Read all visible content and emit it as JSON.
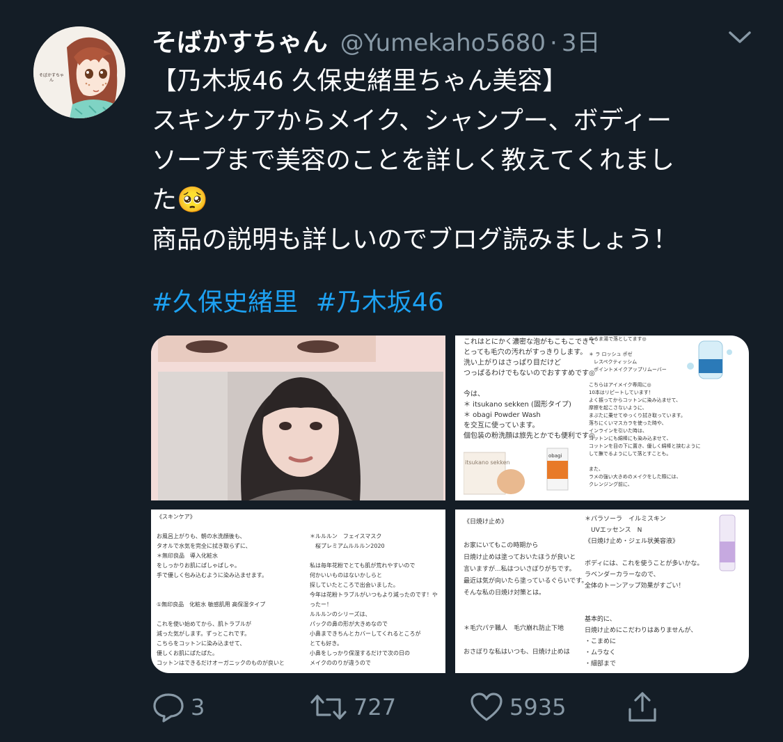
{
  "tweet": {
    "avatar_label": "そばかすちゃん",
    "display_name": "そばかすちゃん",
    "handle": "@Yumekaho5680",
    "separator": "·",
    "time": "3日",
    "lines": [
      "【乃木坂46 久保史緒里ちゃん美容】",
      "スキンケアからメイク、シャンプー、ボディー",
      "ソープまで美容のことを詳しく教えてくれまし",
      "た🥺",
      "商品の説明も詳しいのでブログ読みましょう！"
    ],
    "hashtags": [
      "#久保史緒里",
      "#乃木坂46"
    ]
  },
  "media": {
    "tile2_left": [
      "これはとにかく濃密な泡がもこもこできて",
      "とっても毛穴の汚れがすっきりします。",
      "洗い上がりはさっぱり目だけど",
      "つっぱるわけでもないのでおすすめです◎",
      "",
      "今は、",
      "＊ itsukano sekken (固形タイプ)",
      "＊ obagi Powder Wash",
      "を交互に使っています。",
      "個包装の粉洗顔は旅先とかでも便利です◎"
    ],
    "tile2_right": [
      "ぬるま湯で落としてます◎",
      "",
      "＊ ラ ロッシュ ポゼ",
      "　レスペクティッシム",
      "　ポイントメイクアップリムーバー",
      "",
      "こちらはアイメイク専用に◎",
      "10本はリピートしています！",
      "よく振ってからコットンに染み込ませて、",
      "摩擦を起こさないように、",
      "まぶたに乗せてゆっくり拭き取っています。",
      "落ちにくいマスカラを使った時や、",
      "インラインを引いた時は、",
      "コットンにも綿棒にも染み込ませて、",
      "コットンを目の下に置き、優しく綿棒と挟むように",
      "して撫でるようにして落とすことも。",
      "",
      "また、",
      "ラメの強い大きめのメイクをした際には、",
      "クレンジング前に、"
    ],
    "tile3_left": [
      "《スキンケア》",
      "",
      "お風呂上がりも、朝の水洗顔後も、",
      "タオルで水気を完全に拭き取らずに、",
      "＊無印良品　導入化粧水",
      "をしっかりお肌にぱしゃぱしゃ。",
      "手で優しく包み込むように染み込ませます。",
      "",
      "",
      "①無印良品　化粧水 敏感肌用 高保湿タイプ",
      "",
      "これを使い始めてから、肌トラブルが",
      "減った気がします。ずっとこれです。",
      "こちらをコットンに染み込ませて、",
      "優しくお肌にぱたぱた。",
      "コットンはできるだけオーガニックのものが良いと"
    ],
    "tile3_right": [
      "＊ルルルン　フェイスマスク",
      "　桜プレミアムルルルン2020",
      "",
      "私は毎年花粉でとても肌が荒れやすいので",
      "何かいいものはないかしらと",
      "探していたところで出会いました。",
      "今年は花粉トラブルがいつもより減ったのです！や",
      "ったー！",
      "ルルルンのシリーズは、",
      "パックの鼻の形が大きめなので",
      "小鼻まできちんとカバーしてくれるところが",
      "とても好き。",
      "小鼻をしっかり保湿するだけで次の日の",
      "メイクののりが違うので"
    ],
    "tile4_left": [
      "《日焼け止め》",
      "",
      "お家にいてもこの時期から",
      "日焼け止めは塗っておいたほうが良いと",
      "言いますが...私はついさぼりがちです。",
      "最近は気が向いたら塗っているぐらいです。",
      "そんな私の日焼け対策とは。",
      "",
      "",
      "＊毛穴パテ職人　毛穴崩れ防止下地",
      "",
      "おさぼりな私はいつも、日焼け止めは"
    ],
    "tile4_right": [
      "＊パラソーラ　イルミスキン",
      "　UVエッセンス　N",
      "《日焼け止め・ジェル状美容液》",
      "",
      "ボディには、これを使うことが多いかな。",
      "ラベンダーカラーなので、",
      "全体のトーンアップ効果がすごい！",
      "",
      "",
      "基本的に、",
      "日焼け止めにこだわりはありませんが、",
      "・こまめに",
      "・ムラなく",
      "・細部まで"
    ],
    "product_soap_label": "itsukano sekken",
    "product_box_label": "obagi"
  },
  "actions": {
    "reply_count": "3",
    "retweet_count": "727",
    "like_count": "5935"
  },
  "colors": {
    "background": "#141d26",
    "secondary_text": "#8899a6",
    "link": "#1da1f2"
  }
}
